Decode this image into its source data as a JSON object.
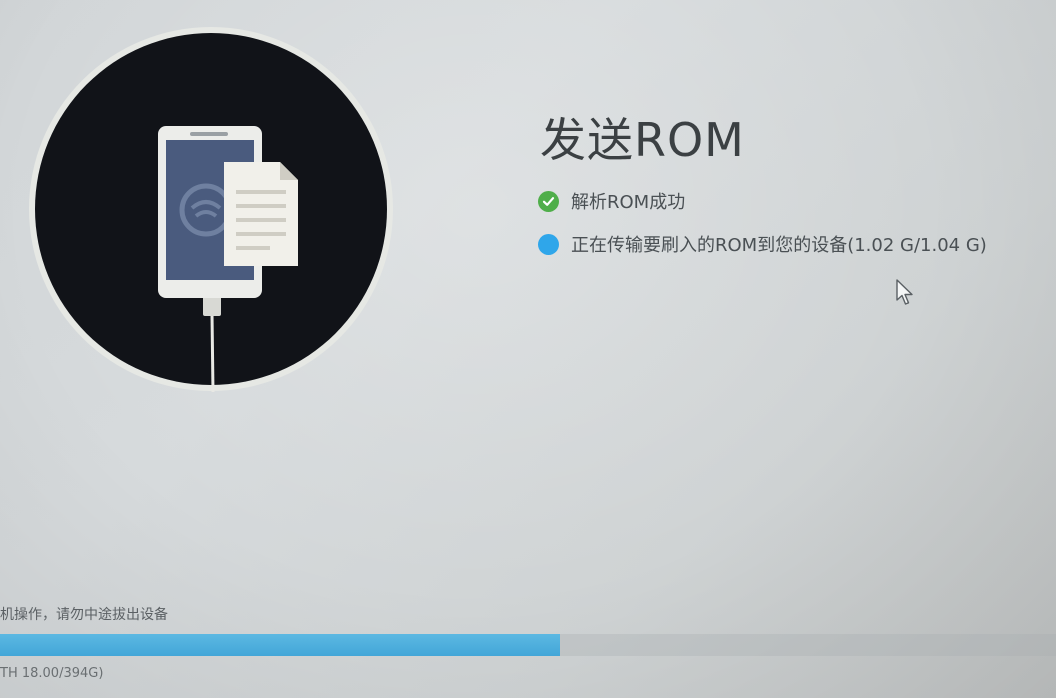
{
  "main": {
    "title": "发送ROM",
    "steps": [
      {
        "text": "解析ROM成功",
        "state": "done",
        "icon": "check-icon",
        "color": "#4fae4a"
      },
      {
        "text": "正在传输要刷入的ROM到您的设备(1.02 G/1.04 G)",
        "state": "in-progress",
        "icon": "progress-dot-icon",
        "color": "#2fa6ea"
      }
    ]
  },
  "footer": {
    "note": "机操作，请勿中途拔出设备",
    "progress": 0.53,
    "progress_text": "TH 18.00/394G)",
    "progress_color": "#42a6d8"
  },
  "illustration": {
    "icon": "phone-sending-file-icon"
  }
}
